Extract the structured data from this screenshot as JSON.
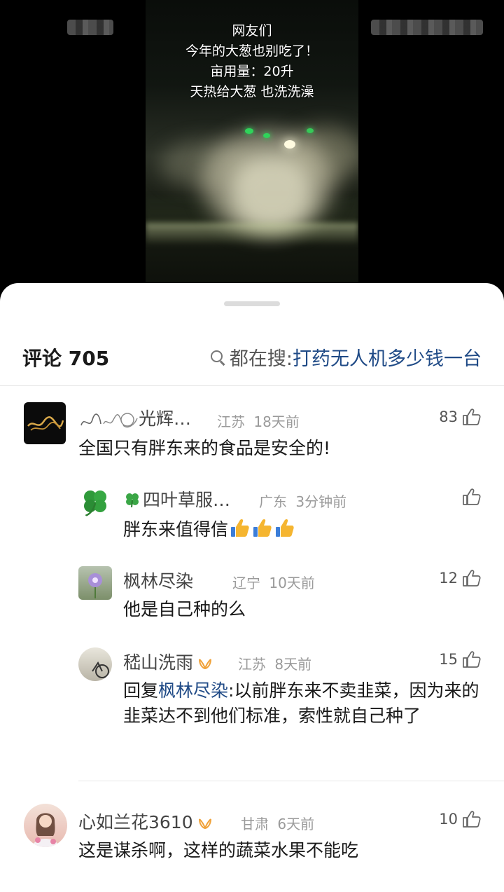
{
  "video": {
    "caption_lines": [
      "网友们",
      "今年的大葱也别吃了！",
      "亩用量：20升",
      "天热给大葱 也洗洗澡"
    ]
  },
  "panel": {
    "title": "评论 705",
    "search_label": "都在搜: ",
    "search_term": "打药无人机多少钱一台"
  },
  "comments": [
    {
      "name": "光辉…",
      "region": "江苏",
      "time": "18天前",
      "likes": "83",
      "text": "全国只有胖东来的食品是安全的!",
      "avatar_icon": "calligraphy-avatar"
    },
    {
      "name": "四叶草服…",
      "region": "广东",
      "time": "3分钟前",
      "likes": "",
      "text": "胖东来值得信",
      "avatar_icon": "clover-icon"
    },
    {
      "name": "枫林尽染",
      "region": "辽宁",
      "time": "10天前",
      "likes": "12",
      "text": "他是自己种的么",
      "avatar_icon": "flower-avatar"
    },
    {
      "name": "嵇山洗雨",
      "region": "江苏",
      "time": "8天前",
      "likes": "15",
      "reply_prefix": "回复",
      "reply_target": "枫林尽染",
      "text": ":以前胖东来不卖韭菜，因为来的韭菜达不到他们标准，索性就自己种了",
      "avatar_icon": "bicycle-avatar"
    },
    {
      "name": "心如兰花3610",
      "region": "甘肃",
      "time": "6天前",
      "likes": "10",
      "text": "这是谋杀啊，这样的蔬菜水果不能吃",
      "avatar_icon": "portrait-avatar"
    }
  ],
  "colors": {
    "link": "#1f4a86",
    "meta": "#9a9a9a",
    "vip_badge": "#f0a23a"
  }
}
